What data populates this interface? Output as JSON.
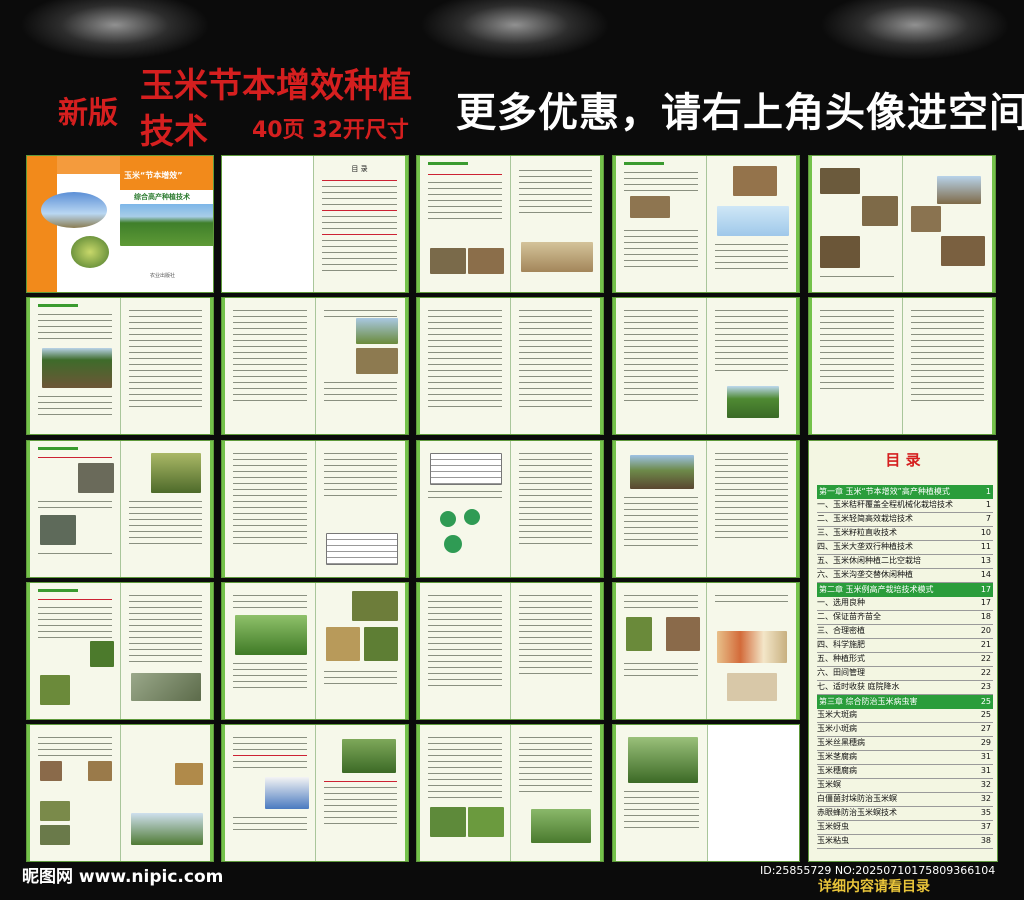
{
  "header": {
    "edition": "新版",
    "title": "玉米节本增效种植",
    "title_line2": "技术",
    "pages_size": "40页  32开尺寸",
    "promo": "更多优惠，请右上角头像进空间"
  },
  "cover": {
    "title_badge": "玉米“节本增效”",
    "subtitle": "综合高产种植技术",
    "publisher": "农业出版社"
  },
  "contents_page": {
    "title": "目 录"
  },
  "toc": {
    "title": "目 录",
    "items": [
      {
        "type": "chapter",
        "text": "第一章  玉米“节本增效”高产种植模式",
        "page": "1"
      },
      {
        "type": "item",
        "text": "一、玉米秸秆覆盖全程机械化栽培技术",
        "page": "1"
      },
      {
        "type": "item",
        "text": "二、玉米轻简高效栽培技术",
        "page": "7"
      },
      {
        "type": "item",
        "text": "三、玉米籽粒直收技术",
        "page": "10"
      },
      {
        "type": "item",
        "text": "四、玉米大垄双行种植技术",
        "page": "11"
      },
      {
        "type": "item",
        "text": "五、玉米休闲种植二比空栽培",
        "page": "13"
      },
      {
        "type": "item",
        "text": "六、玉米沟垄交替休闲种植",
        "page": "14"
      },
      {
        "type": "chapter",
        "text": "第二章  玉米例高产栽培技术模式",
        "page": "17"
      },
      {
        "type": "item",
        "text": "一、选用良种",
        "page": "17"
      },
      {
        "type": "item",
        "text": "二、保证苗齐苗全",
        "page": "18"
      },
      {
        "type": "item",
        "text": "三、合理密植",
        "page": "20"
      },
      {
        "type": "item",
        "text": "四、科学施肥",
        "page": "21"
      },
      {
        "type": "item",
        "text": "五、种植形式",
        "page": "22"
      },
      {
        "type": "item",
        "text": "六、田间管理",
        "page": "22"
      },
      {
        "type": "item",
        "text": "七、适时收获  庭院降水",
        "page": "23"
      },
      {
        "type": "chapter",
        "text": "第三章  综合防治玉米病虫害",
        "page": "25"
      },
      {
        "type": "item",
        "text": "玉米大斑病",
        "page": "25"
      },
      {
        "type": "item",
        "text": "玉米小斑病",
        "page": "27"
      },
      {
        "type": "item",
        "text": "玉米丝黑穗病",
        "page": "29"
      },
      {
        "type": "item",
        "text": "玉米茎腐病",
        "page": "31"
      },
      {
        "type": "item",
        "text": "玉米穗腐病",
        "page": "31"
      },
      {
        "type": "item",
        "text": "玉米螟",
        "page": "32"
      },
      {
        "type": "item",
        "text": "白僵菌封垛防治玉米螟",
        "page": "32"
      },
      {
        "type": "item",
        "text": "赤眼蜂防治玉米螟技术",
        "page": "35"
      },
      {
        "type": "item",
        "text": "玉米蚜虫",
        "page": "37"
      },
      {
        "type": "item",
        "text": "玉米粘虫",
        "page": "38"
      }
    ]
  },
  "footer": {
    "watermark": "昵图网 www.nipic.com",
    "image_id": "ID:25855729 NO:20250710175809366104",
    "note": "详细内容请看目录"
  },
  "colors": {
    "title_red": "#d51f1f",
    "page_border_green": "#74c24a",
    "chapter_bar_green": "#2a9d3b",
    "cover_orange": "#f28a1b"
  }
}
